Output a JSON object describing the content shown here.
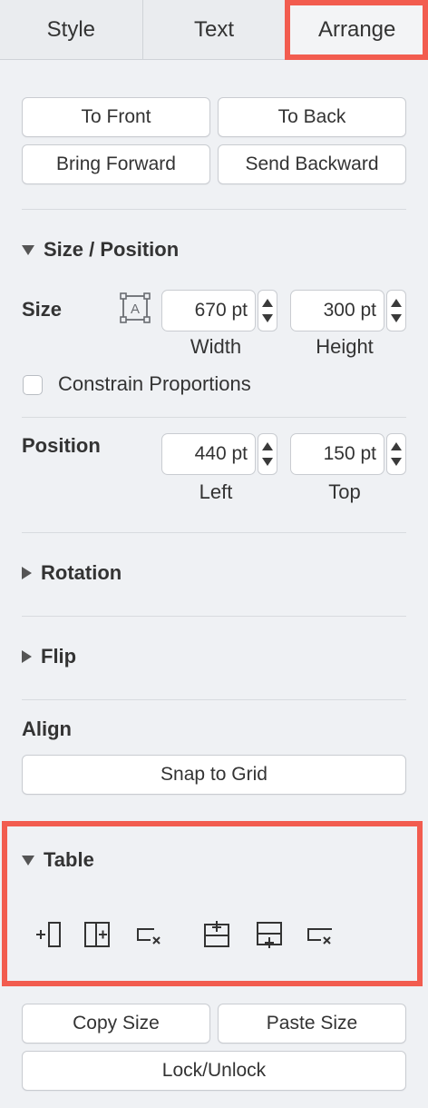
{
  "tabs": [
    {
      "label": "Style"
    },
    {
      "label": "Text"
    },
    {
      "label": "Arrange"
    }
  ],
  "active_tab": "Arrange",
  "arrange_buttons": {
    "to_front": "To Front",
    "to_back": "To Back",
    "bring_forward": "Bring Forward",
    "send_backward": "Send Backward"
  },
  "size_position": {
    "title": "Size / Position",
    "size_label": "Size",
    "width_value": "670 pt",
    "height_value": "300 pt",
    "width_label": "Width",
    "height_label": "Height",
    "constrain_label": "Constrain Proportions",
    "position_label": "Position",
    "left_value": "440 pt",
    "top_value": "150 pt",
    "left_label": "Left",
    "top_label": "Top"
  },
  "rotation": {
    "title": "Rotation"
  },
  "flip": {
    "title": "Flip"
  },
  "align": {
    "title": "Align",
    "snap_label": "Snap to Grid"
  },
  "table": {
    "title": "Table",
    "tools": [
      "insert-column-before-icon",
      "insert-column-after-icon",
      "delete-column-icon",
      "insert-row-before-icon",
      "insert-row-after-icon",
      "delete-row-icon"
    ]
  },
  "bottom_buttons": {
    "copy_size": "Copy Size",
    "paste_size": "Paste Size",
    "lock_unlock": "Lock/Unlock"
  },
  "colors": {
    "highlight": "#f25c4f",
    "panel_bg": "#eff1f4"
  }
}
